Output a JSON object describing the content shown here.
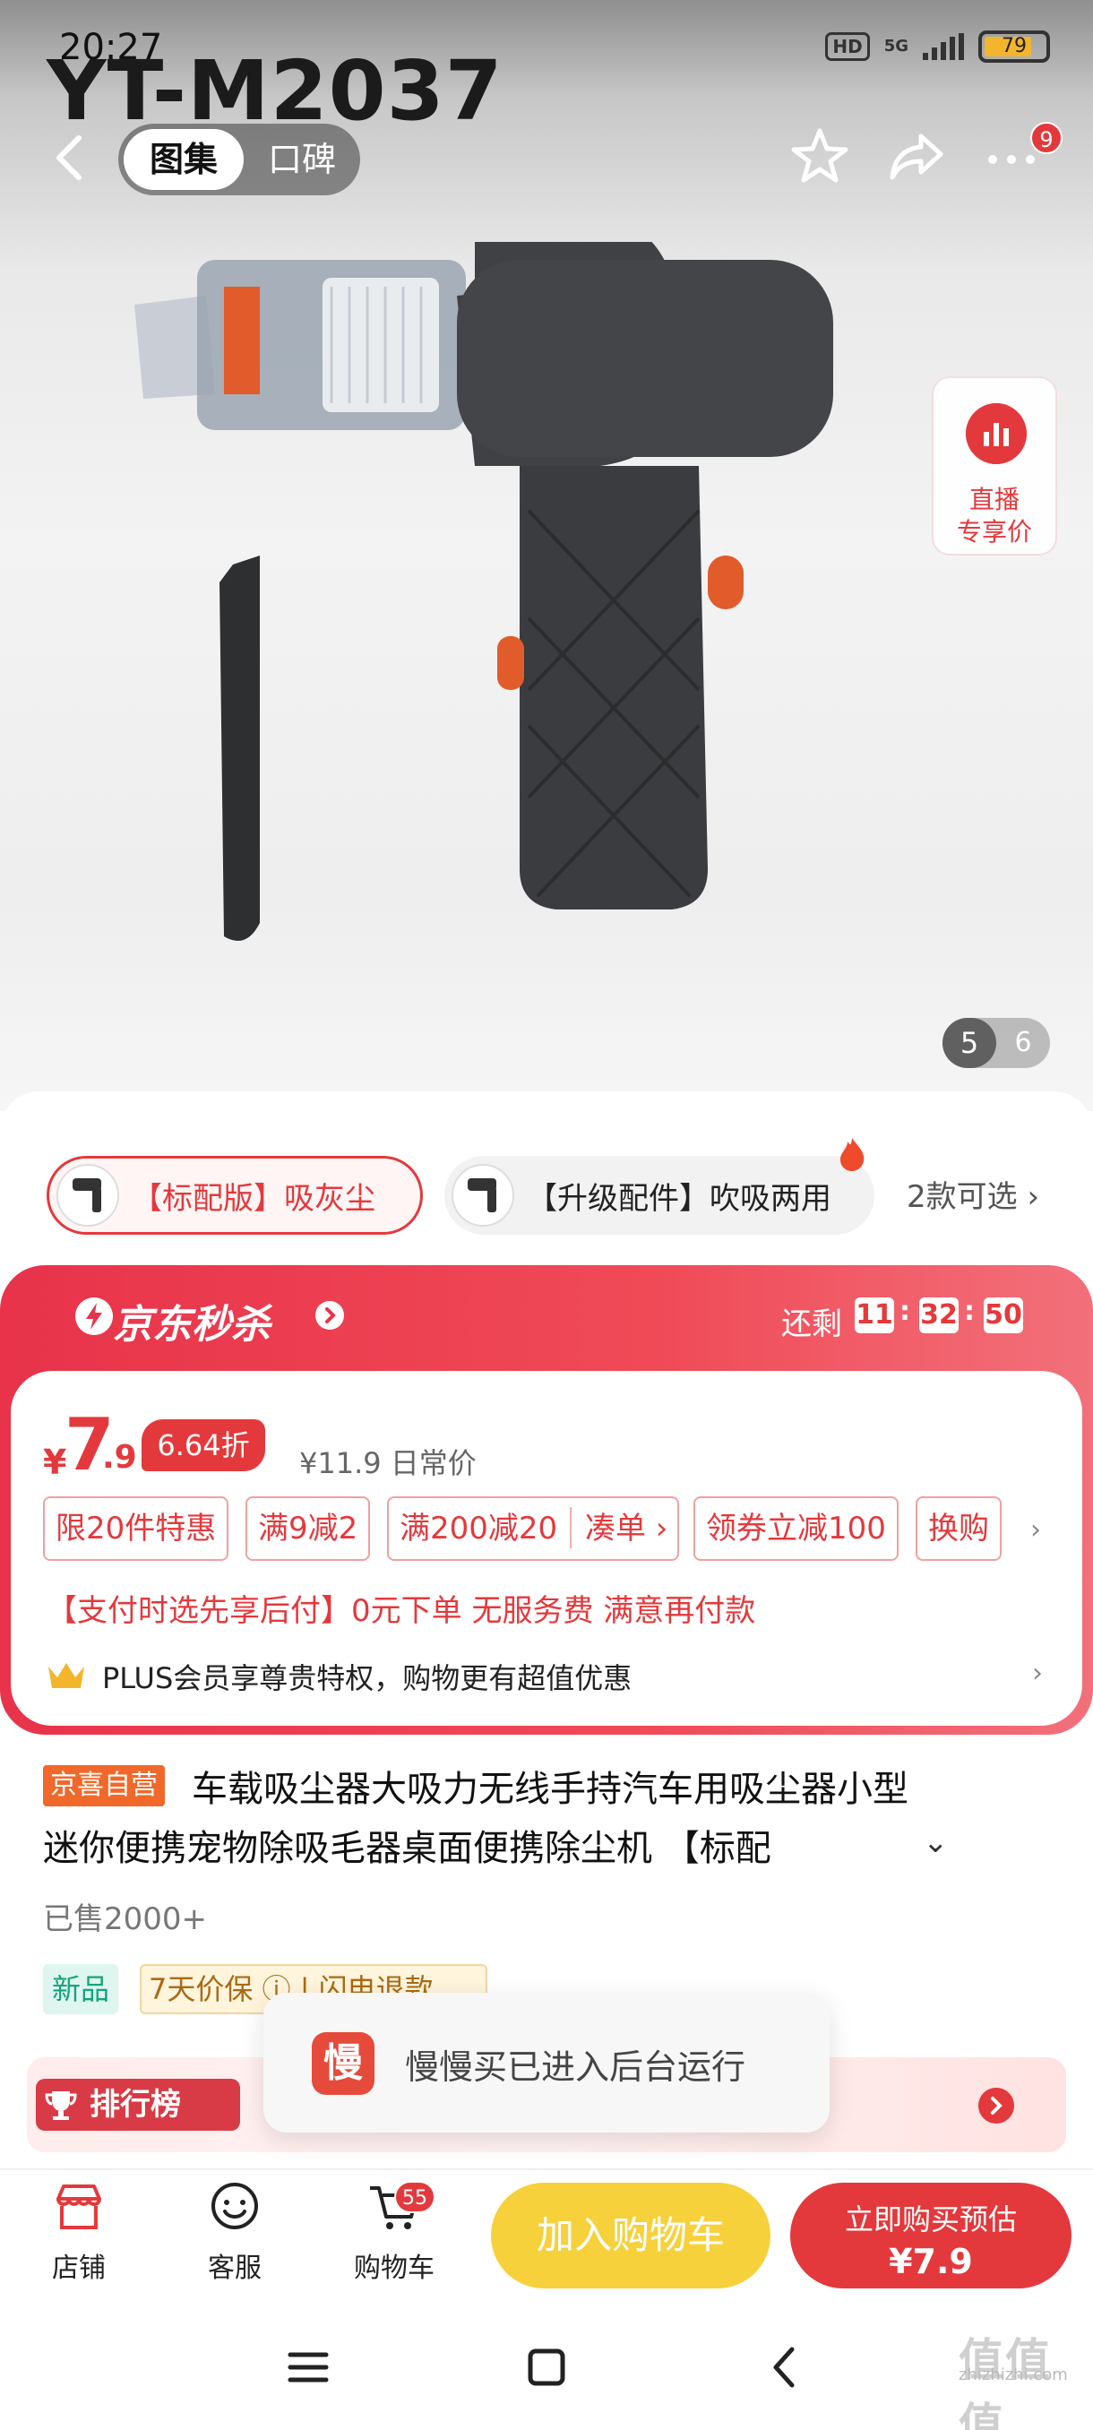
{
  "status": {
    "time": "20:27",
    "hd": "HD",
    "network": "5G",
    "battery": "79"
  },
  "overlay": {
    "model_text": "YT-M2037"
  },
  "topnav": {
    "tabs": [
      "图集",
      "口碑"
    ],
    "active_tab": "图集",
    "more_badge": "9"
  },
  "gallery": {
    "live_label_1": "直播",
    "live_label_2": "专享价",
    "current": "5",
    "total": "6"
  },
  "variants": {
    "items": [
      "【标配版】吸灰尘",
      "【升级配件】吹吸两用"
    ],
    "selected": "【标配版】吸灰尘",
    "more": "2款可选 ›"
  },
  "seckill": {
    "title": "京东秒杀",
    "remaining_label": "还剩",
    "hh": "11",
    "mm": "32",
    "ss": "50"
  },
  "price": {
    "currency": "¥",
    "integer": "7",
    "decimal": ".9",
    "discount": "6.64折",
    "original": "¥11.9 日常价"
  },
  "promos": [
    "限20件特惠",
    "满9减2",
    "满200减20",
    "凑单 ›",
    "领券立减100",
    "换购"
  ],
  "promo_more": "›",
  "paylater": "【支付时选先享后付】0元下单 无服务费 满意再付款",
  "plus": {
    "text": "PLUS会员享尊贵特权，购物更有超值优惠",
    "more": "›"
  },
  "product": {
    "self_tag": "京喜自营",
    "title_line1": "车载吸尘器大吸力无线手持汽车用吸尘器小型",
    "title_line2": "迷你便携宠物除吸毛器桌面便携除尘机 【标配",
    "expand": "⌄",
    "sold": "已售2000+",
    "tag_new": "新品",
    "tag_guard": "7天价保 ⓘ | 闪电退款"
  },
  "ranking": {
    "label": "排行榜"
  },
  "toast": {
    "icon_char": "慢",
    "text": "慢慢买已进入后台运行"
  },
  "actionbar": {
    "shop": "店铺",
    "service": "客服",
    "cart": "购物车",
    "cart_count": "55",
    "add_to_cart": "加入购物车",
    "buy_now_1": "立即购买预估",
    "buy_now_2": "¥7.9"
  },
  "watermark": {
    "site": "zhizhizhi.com",
    "logo": "值值值"
  },
  "colors": {
    "jd_red": "#e4393c",
    "yellow_button": "#f7d13c",
    "self_tag_orange": "#f0682a"
  }
}
